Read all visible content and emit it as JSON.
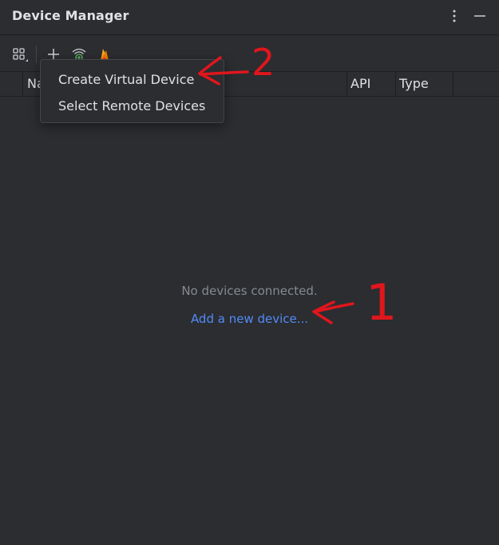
{
  "window": {
    "title": "Device Manager",
    "more_icon": "vertical-ellipsis-icon",
    "minimize_icon": "minimize-icon"
  },
  "toolbar": {
    "tools": [
      "group-layout-icon",
      "plus-icon",
      "wifi-pair-icon",
      "firebase-icon"
    ]
  },
  "table": {
    "columns": [
      "Na",
      "API",
      "Type"
    ]
  },
  "popup_menu": {
    "items": [
      "Create Virtual Device",
      "Select Remote Devices"
    ]
  },
  "empty_state": {
    "message": "No devices connected.",
    "link": "Add a new device..."
  },
  "annotations": {
    "label_1": "1",
    "label_2": "2",
    "color": "#e0161d"
  },
  "colors": {
    "background": "#2b2d30",
    "link": "#548af7",
    "muted_text": "#868a91"
  }
}
